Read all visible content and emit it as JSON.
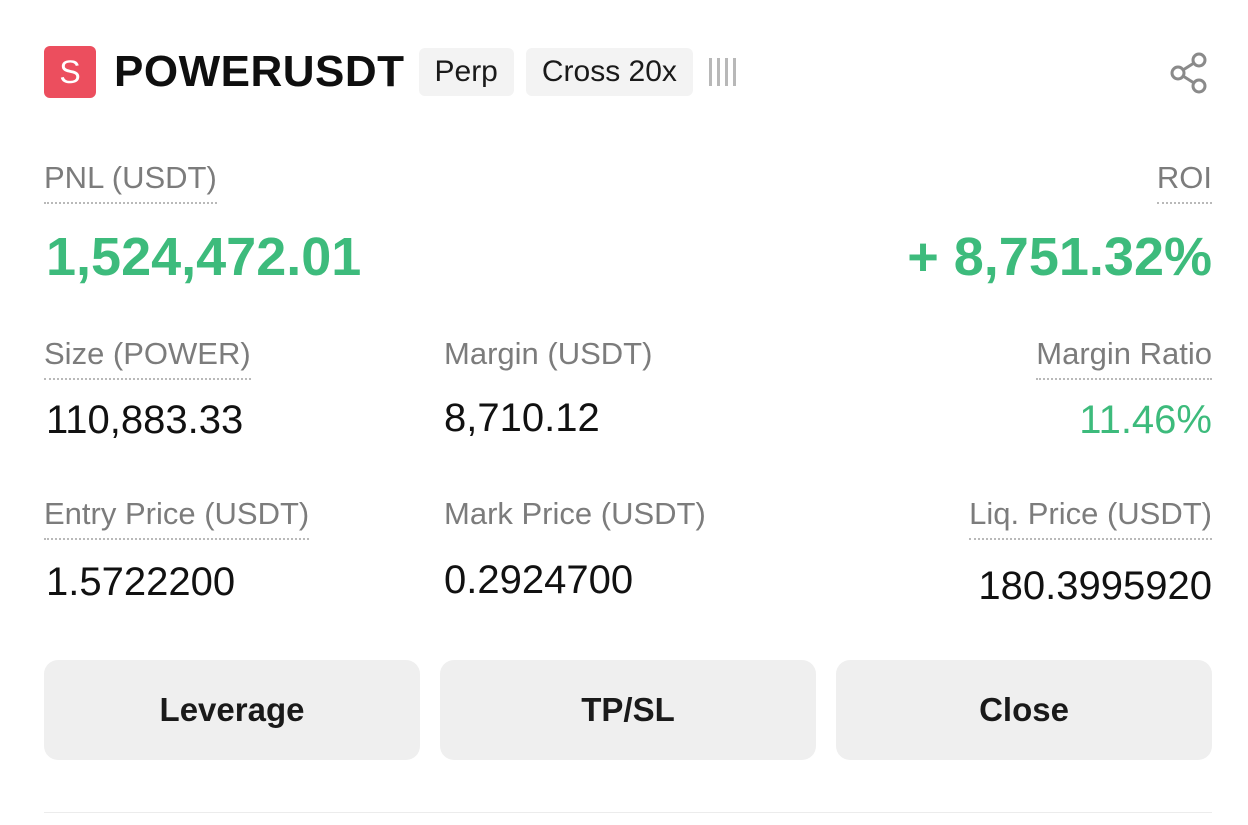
{
  "header": {
    "badge_letter": "S",
    "symbol": "POWERUSDT",
    "tags": [
      "Perp",
      "Cross 20x"
    ],
    "share_icon": "share-icon"
  },
  "pnl": {
    "label": "PNL (USDT)",
    "value": "1,524,472.01"
  },
  "roi": {
    "label": "ROI",
    "value": "+ 8,751.32%"
  },
  "stats": {
    "size": {
      "label": "Size (POWER)",
      "value": "110,883.33"
    },
    "margin": {
      "label": "Margin (USDT)",
      "value": "8,710.12"
    },
    "margin_ratio": {
      "label": "Margin Ratio",
      "value": "11.46%"
    },
    "entry_price": {
      "label": "Entry Price (USDT)",
      "value": "1.5722200"
    },
    "mark_price": {
      "label": "Mark Price (USDT)",
      "value": "0.2924700"
    },
    "liq_price": {
      "label": "Liq. Price (USDT)",
      "value": "180.3995920"
    }
  },
  "actions": {
    "leverage": "Leverage",
    "tpsl": "TP/SL",
    "close": "Close"
  },
  "colors": {
    "profit_green": "#3dbb7c",
    "badge_red": "#ec4e5e",
    "label_gray": "#7c7c7c"
  }
}
